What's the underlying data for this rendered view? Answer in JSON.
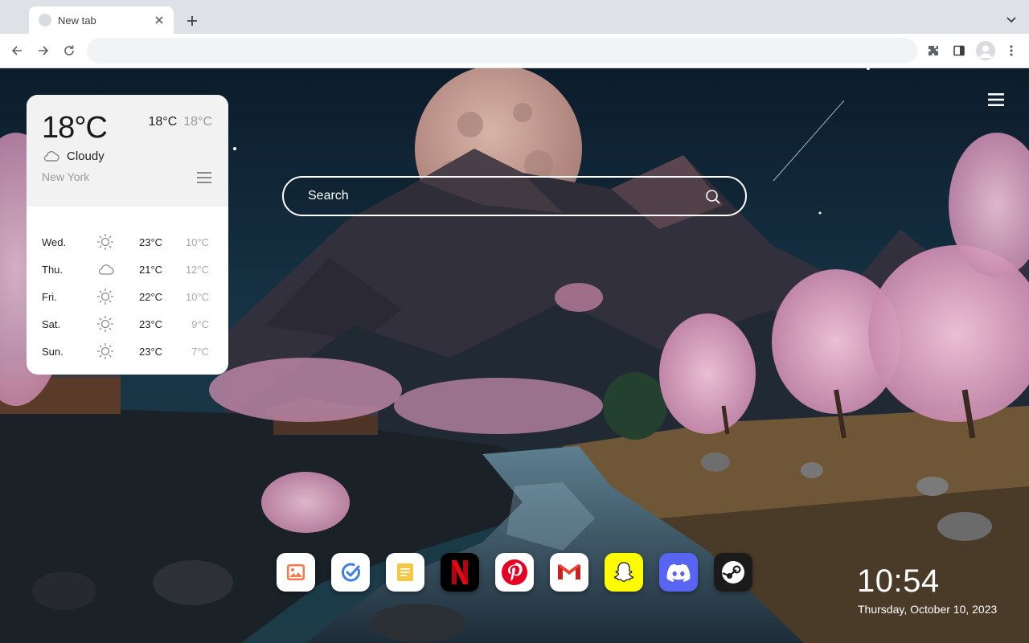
{
  "browser": {
    "tab_title": "New tab",
    "address_value": "",
    "icons": {
      "tab_close": "close-icon",
      "new_tab": "plus-icon",
      "tab_search": "chevron-down-icon",
      "back": "arrow-left-icon",
      "forward": "arrow-right-icon",
      "reload": "reload-icon",
      "extensions": "puzzle-icon",
      "side_panel": "side-panel-icon",
      "profile": "avatar-icon",
      "menu": "kebab-icon"
    }
  },
  "weather": {
    "current_temp": "18°C",
    "high": "18°C",
    "low": "18°C",
    "condition": "Cloudy",
    "condition_icon": "cloud-icon",
    "city": "New York",
    "forecast": [
      {
        "day": "Wed.",
        "icon": "sun-icon",
        "high": "23°C",
        "low": "10°C"
      },
      {
        "day": "Thu.",
        "icon": "cloud-icon",
        "high": "21°C",
        "low": "12°C"
      },
      {
        "day": "Fri.",
        "icon": "sun-icon",
        "high": "22°C",
        "low": "10°C"
      },
      {
        "day": "Sat.",
        "icon": "sun-icon",
        "high": "23°C",
        "low": "9°C"
      },
      {
        "day": "Sun.",
        "icon": "sun-icon",
        "high": "23°C",
        "low": "7°C"
      }
    ]
  },
  "search": {
    "placeholder": "Search",
    "icon": "search-icon"
  },
  "apps": [
    {
      "name": "gallery",
      "icon": "image-icon",
      "bg": "#ffffff"
    },
    {
      "name": "tasks",
      "icon": "check-circle-icon",
      "bg": "#ffffff"
    },
    {
      "name": "notes",
      "icon": "note-icon",
      "bg": "#ffffff"
    },
    {
      "name": "netflix",
      "icon": "netflix-icon",
      "bg": "#000000"
    },
    {
      "name": "pinterest",
      "icon": "pinterest-icon",
      "bg": "#ffffff"
    },
    {
      "name": "gmail",
      "icon": "gmail-icon",
      "bg": "#ffffff"
    },
    {
      "name": "snapchat",
      "icon": "snapchat-icon",
      "bg": "#fffc00"
    },
    {
      "name": "discord",
      "icon": "discord-icon",
      "bg": "#5865f2"
    },
    {
      "name": "steam",
      "icon": "steam-icon",
      "bg": "#1b1b1b"
    }
  ],
  "clock": {
    "time": "10:54",
    "date": "Thursday, October 10, 2023"
  },
  "colors": {
    "netflix_red": "#e50914",
    "pinterest_red": "#e60023",
    "gmail_red": "#ea4335",
    "discord_blurple": "#5865f2",
    "snapchat_yellow": "#fffc00"
  }
}
